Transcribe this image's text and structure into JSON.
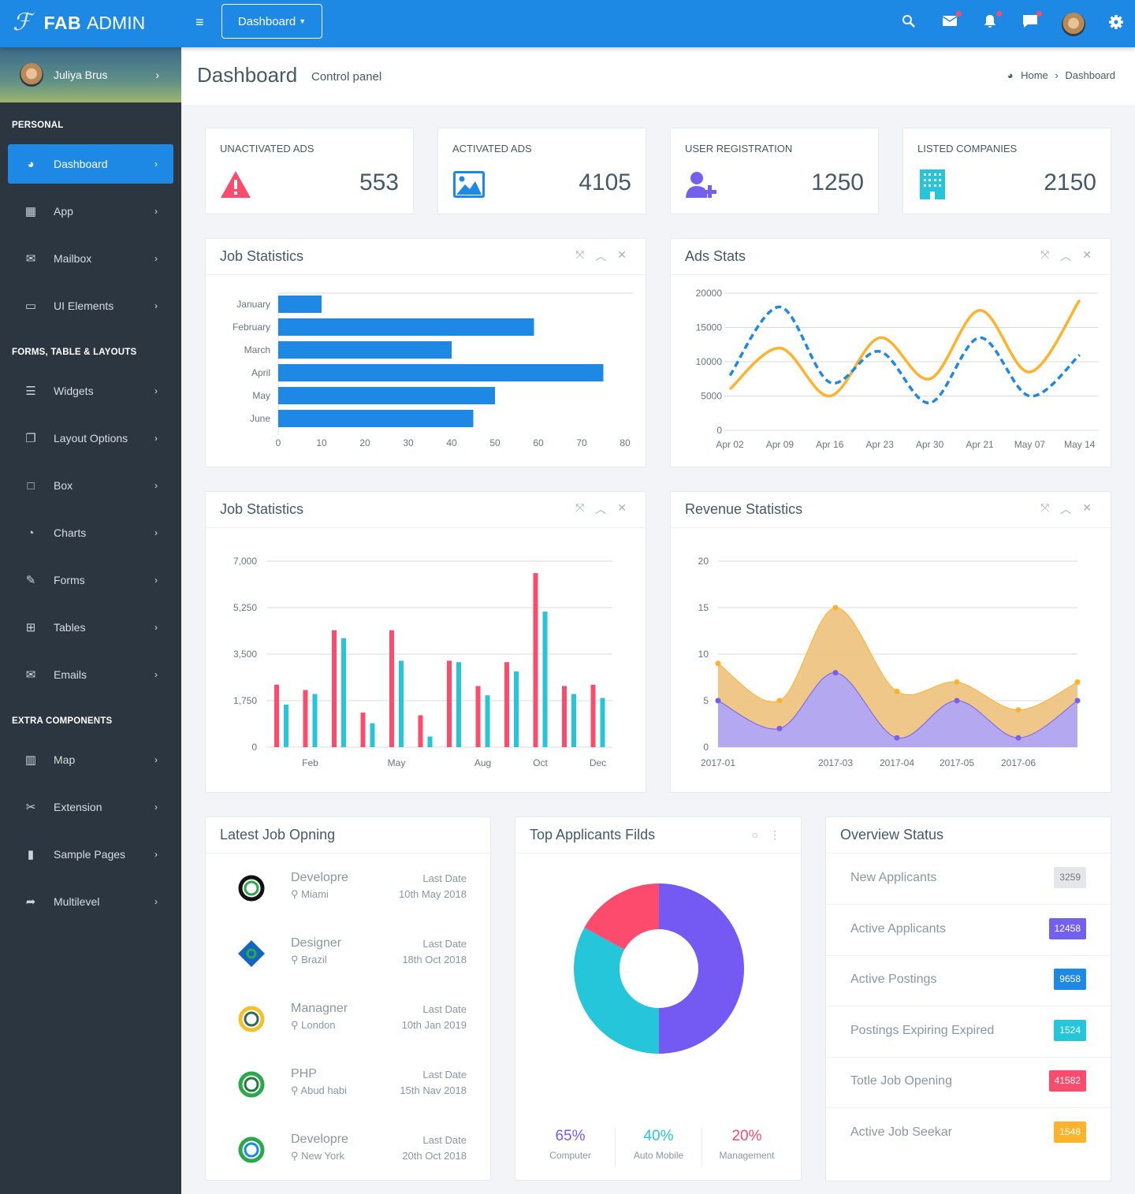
{
  "header": {
    "brand_bold": "FAB",
    "brand_rest": "ADMIN",
    "dropdown_label": "Dashboard",
    "icons": [
      "menu-icon",
      "search-icon",
      "mail-icon",
      "bell-icon",
      "chat-icon",
      "avatar",
      "gear-icon"
    ]
  },
  "sidebar": {
    "user_name": "Juliya Brus",
    "sections": [
      {
        "title": "PERSONAL",
        "items": [
          {
            "label": "Dashboard",
            "icon": "dashboard-icon",
            "glyph": "◕",
            "active": true
          },
          {
            "label": "App",
            "icon": "grid-icon",
            "glyph": "▦"
          },
          {
            "label": "Mailbox",
            "icon": "envelope-icon",
            "glyph": "✉"
          },
          {
            "label": "UI Elements",
            "icon": "laptop-icon",
            "glyph": "▭"
          }
        ]
      },
      {
        "title": "FORMS, TABLE & LAYOUTS",
        "items": [
          {
            "label": "Widgets",
            "icon": "bars-icon",
            "glyph": "☰"
          },
          {
            "label": "Layout Options",
            "icon": "copy-icon",
            "glyph": "❐"
          },
          {
            "label": "Box",
            "icon": "square-icon",
            "glyph": "□"
          },
          {
            "label": "Charts",
            "icon": "pie-chart-icon",
            "glyph": "◔"
          },
          {
            "label": "Forms",
            "icon": "edit-icon",
            "glyph": "✎"
          },
          {
            "label": "Tables",
            "icon": "table-icon",
            "glyph": "⊞"
          },
          {
            "label": "Emails",
            "icon": "envelope-open-icon",
            "glyph": "✉"
          }
        ]
      },
      {
        "title": "EXTRA COMPONENTS",
        "items": [
          {
            "label": "Map",
            "icon": "map-icon",
            "glyph": "▥"
          },
          {
            "label": "Extension",
            "icon": "plug-icon",
            "glyph": "✂"
          },
          {
            "label": "Sample Pages",
            "icon": "file-icon",
            "glyph": "▮"
          },
          {
            "label": "Multilevel",
            "icon": "share-icon",
            "glyph": "➦"
          }
        ]
      }
    ]
  },
  "page": {
    "title": "Dashboard",
    "subtitle": "Control panel",
    "breadcrumb": [
      "Home",
      "Dashboard"
    ]
  },
  "stats": [
    {
      "label": "UNACTIVATED ADS",
      "value": "553",
      "icon": "warning-icon",
      "color": "#fc4b6c"
    },
    {
      "label": "ACTIVATED ADS",
      "value": "4105",
      "icon": "image-icon",
      "color": "#1e88e5"
    },
    {
      "label": "USER REGISTRATION",
      "value": "1250",
      "icon": "user-plus-icon",
      "color": "#7460ee"
    },
    {
      "label": "LISTED COMPANIES",
      "value": "2150",
      "icon": "building-icon",
      "color": "#26c6da"
    }
  ],
  "panels": {
    "job_stats_1": "Job Statistics",
    "ads_stats": "Ads Stats",
    "job_stats_2": "Job Statistics",
    "revenue": "Revenue Statistics",
    "latest_jobs": "Latest Job Opning",
    "top_applicants": "Top Applicants Filds",
    "overview": "Overview Status"
  },
  "chart_data": [
    {
      "type": "bar",
      "orientation": "horizontal",
      "categories": [
        "January",
        "February",
        "March",
        "April",
        "May",
        "June"
      ],
      "values": [
        10,
        59,
        40,
        75,
        50,
        45
      ],
      "xlim": [
        0,
        80
      ],
      "xticks": [
        0,
        10,
        20,
        30,
        40,
        50,
        60,
        70,
        80
      ],
      "color": "#1e88e5"
    },
    {
      "type": "line",
      "categories": [
        "Apr 02",
        "Apr 09",
        "Apr 16",
        "Apr 23",
        "Apr 30",
        "Apr 21",
        "May 07",
        "May 14"
      ],
      "ylim": [
        0,
        20000
      ],
      "yticks": [
        0,
        5000,
        10000,
        15000,
        20000
      ],
      "series": [
        {
          "values": [
            6000,
            12000,
            5000,
            13500,
            7500,
            17500,
            8500,
            19000
          ],
          "color": "#ffb22b",
          "style": "solid"
        },
        {
          "values": [
            8000,
            18000,
            7000,
            11500,
            4000,
            13500,
            5000,
            11000
          ],
          "color": "#1e88e5",
          "style": "dashed"
        }
      ]
    },
    {
      "type": "bar",
      "categories": [
        "Jan",
        "Feb",
        "Mar",
        "Apr",
        "May",
        "Jun",
        "Jul",
        "Aug",
        "Sep",
        "Oct",
        "Nov",
        "Dec"
      ],
      "visible_tick_labels": [
        "",
        "Feb",
        "",
        "",
        "May",
        "",
        "",
        "Aug",
        "",
        "Oct",
        "",
        "Dec"
      ],
      "ylim": [
        0,
        7000
      ],
      "yticks": [
        "0",
        "1,750",
        "3,500",
        "5,250",
        "7,000"
      ],
      "series": [
        {
          "values": [
            2350,
            2150,
            4400,
            1300,
            4400,
            1200,
            3250,
            2300,
            3200,
            6550,
            2300,
            2350
          ],
          "color": "#fc4b6c"
        },
        {
          "values": [
            1600,
            2000,
            4100,
            900,
            3250,
            400,
            3200,
            1950,
            2850,
            5100,
            2000,
            1850
          ],
          "color": "#26c6da"
        }
      ]
    },
    {
      "type": "area",
      "categories": [
        "2017-01",
        "",
        "2017-03",
        "2017-04",
        "2017-05",
        "2017-06",
        ""
      ],
      "ylim": [
        0,
        20
      ],
      "yticks": [
        0,
        5,
        10,
        15,
        20
      ],
      "series": [
        {
          "values": [
            9,
            5,
            15,
            6,
            7,
            4,
            7
          ],
          "color": "#ffb22b"
        },
        {
          "values": [
            5,
            2,
            8,
            1,
            5,
            1,
            5
          ],
          "color": "#7460ee"
        }
      ]
    },
    {
      "type": "pie",
      "donut": true,
      "values": [
        50,
        33,
        17
      ],
      "colors": [
        "#745af2",
        "#26c6da",
        "#fc4b6c"
      ]
    }
  ],
  "donut_legend": [
    {
      "pct": "65%",
      "label": "Computer",
      "color": "#745af2"
    },
    {
      "pct": "40%",
      "label": "Auto Mobile",
      "color": "#26c6da"
    },
    {
      "pct": "20%",
      "label": "Management",
      "color": "#fc4b6c"
    }
  ],
  "jobs": [
    {
      "title": "Developre",
      "location": "Miami",
      "date_label": "Last Date",
      "date": "10th May 2018",
      "logo": "company-logo-c",
      "colors": [
        "#111",
        "#2aa84a"
      ]
    },
    {
      "title": "Designer",
      "location": "Brazil",
      "date_label": "Last Date",
      "date": "18th Oct 2018",
      "logo": "company-logo-diamond",
      "colors": [
        "#1565c0",
        "#2aa84a"
      ]
    },
    {
      "title": "Managner",
      "location": "London",
      "date_label": "Last Date",
      "date": "10th Jan 2019",
      "logo": "company-logo-g",
      "colors": [
        "#f2c12e",
        "#2e6b57"
      ]
    },
    {
      "title": "PHP",
      "location": "Abud habi",
      "date_label": "Last Date",
      "date": "15th Nav 2018",
      "logo": "company-logo-leaf",
      "colors": [
        "#2aa84a",
        "#1e7d3a"
      ]
    },
    {
      "title": "Developre",
      "location": "New York",
      "date_label": "Last Date",
      "date": "20th Oct 2018",
      "logo": "company-logo-e",
      "colors": [
        "#2aa84a",
        "#1e88e5"
      ]
    }
  ],
  "overview": [
    {
      "label": "New Applicants",
      "count": "3259",
      "color": "#e4e6e9",
      "text": "#777"
    },
    {
      "label": "Active Applicants",
      "count": "12458",
      "color": "#7460ee",
      "text": "#fff"
    },
    {
      "label": "Active Postings",
      "count": "9658",
      "color": "#1e88e5",
      "text": "#fff"
    },
    {
      "label": "Postings Expiring Expired",
      "count": "1524",
      "color": "#26c6da",
      "text": "#fff"
    },
    {
      "label": "Totle Job Opening",
      "count": "41582",
      "color": "#fc4b6c",
      "text": "#fff"
    },
    {
      "label": "Active Job Seekar",
      "count": "1548",
      "color": "#ffb22b",
      "text": "#fff"
    }
  ]
}
